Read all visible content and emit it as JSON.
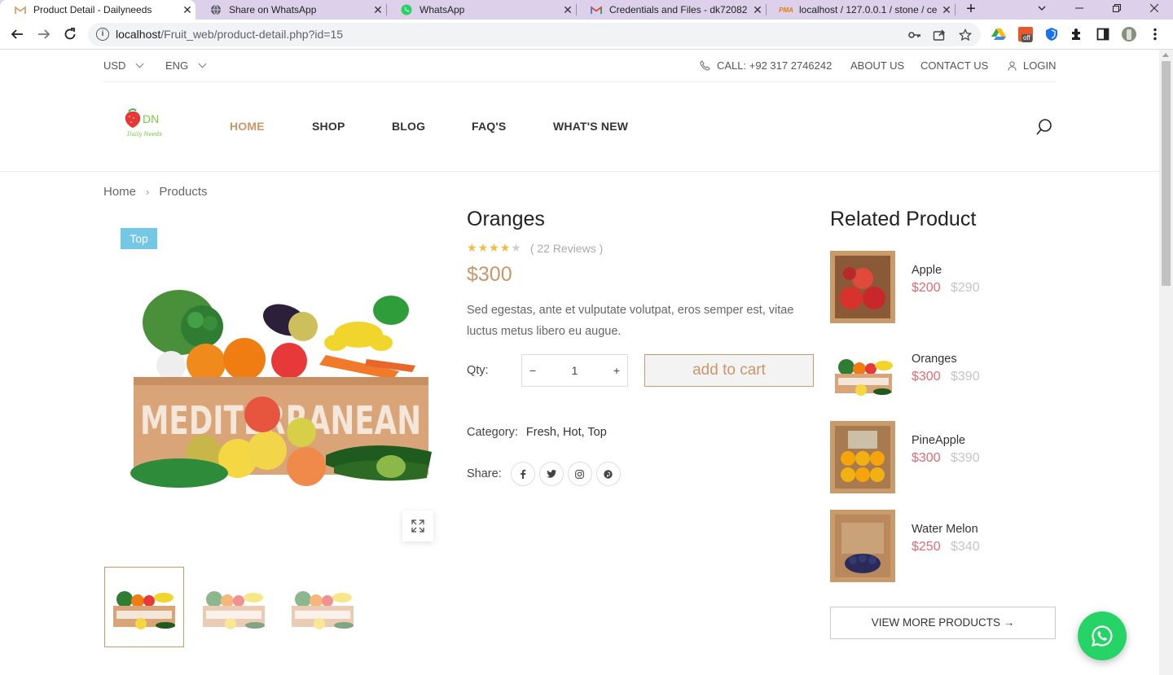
{
  "browser": {
    "tabs": [
      {
        "title": "Product Detail - Dailyneeds",
        "icon": "gmail-icon",
        "active": true
      },
      {
        "title": "Share on WhatsApp",
        "icon": "globe-icon",
        "active": false
      },
      {
        "title": "WhatsApp",
        "icon": "whatsapp-icon",
        "active": false
      },
      {
        "title": "Credentials and Files - dk72082",
        "icon": "gmail-icon",
        "active": false
      },
      {
        "title": "localhost / 127.0.0.1 / stone / ce",
        "icon": "phpmyadmin-icon",
        "active": false
      }
    ],
    "url_host": "localhost",
    "url_path": "/Fruit_web/product-detail.php?id=15",
    "ext_badge": "off"
  },
  "topbar": {
    "currency": "USD",
    "language": "ENG",
    "call": "CALL: +92 317 2746242",
    "about": "ABOUT US",
    "contact": "CONTACT US",
    "login": "LOGIN"
  },
  "logo": {
    "text": "DN",
    "tagline": "Daily Needs"
  },
  "nav": [
    {
      "label": "HOME",
      "active": true
    },
    {
      "label": "SHOP"
    },
    {
      "label": "BLOG"
    },
    {
      "label": "FAQ'S"
    },
    {
      "label": "WHAT'S NEW"
    }
  ],
  "breadcrumb": {
    "home": "Home",
    "current": "Products"
  },
  "product": {
    "badge": "Top",
    "title": "Oranges",
    "rating": 4,
    "rating_max": 5,
    "reviews": "( 22 Reviews )",
    "price": "$300",
    "description": "Sed egestas, ante et vulputate volutpat, eros semper est, vitae luctus metus libero eu augue.",
    "qty_label": "Qty:",
    "qty_minus": "−",
    "qty_value": "1",
    "qty_plus": "+",
    "add_to_cart": "add to cart",
    "category_label": "Category:",
    "category_value": "Fresh, Hot, Top",
    "share_label": "Share:",
    "box_text": "MEDITERRANEAN"
  },
  "related": {
    "heading": "Related Product",
    "items": [
      {
        "name": "Apple",
        "price": "$200",
        "old_price": "$290"
      },
      {
        "name": "Oranges",
        "price": "$300",
        "old_price": "$390"
      },
      {
        "name": "PineApple",
        "price": "$300",
        "old_price": "$390"
      },
      {
        "name": "Water Melon",
        "price": "$250",
        "old_price": "$340"
      }
    ],
    "view_more": "VIEW MORE PRODUCTS →"
  },
  "colors": {
    "accent": "#c8976a",
    "sale": "#e06c75",
    "badge": "#75c8e3",
    "whatsapp": "#25d366",
    "tabstrip": "#dcd0ea"
  }
}
